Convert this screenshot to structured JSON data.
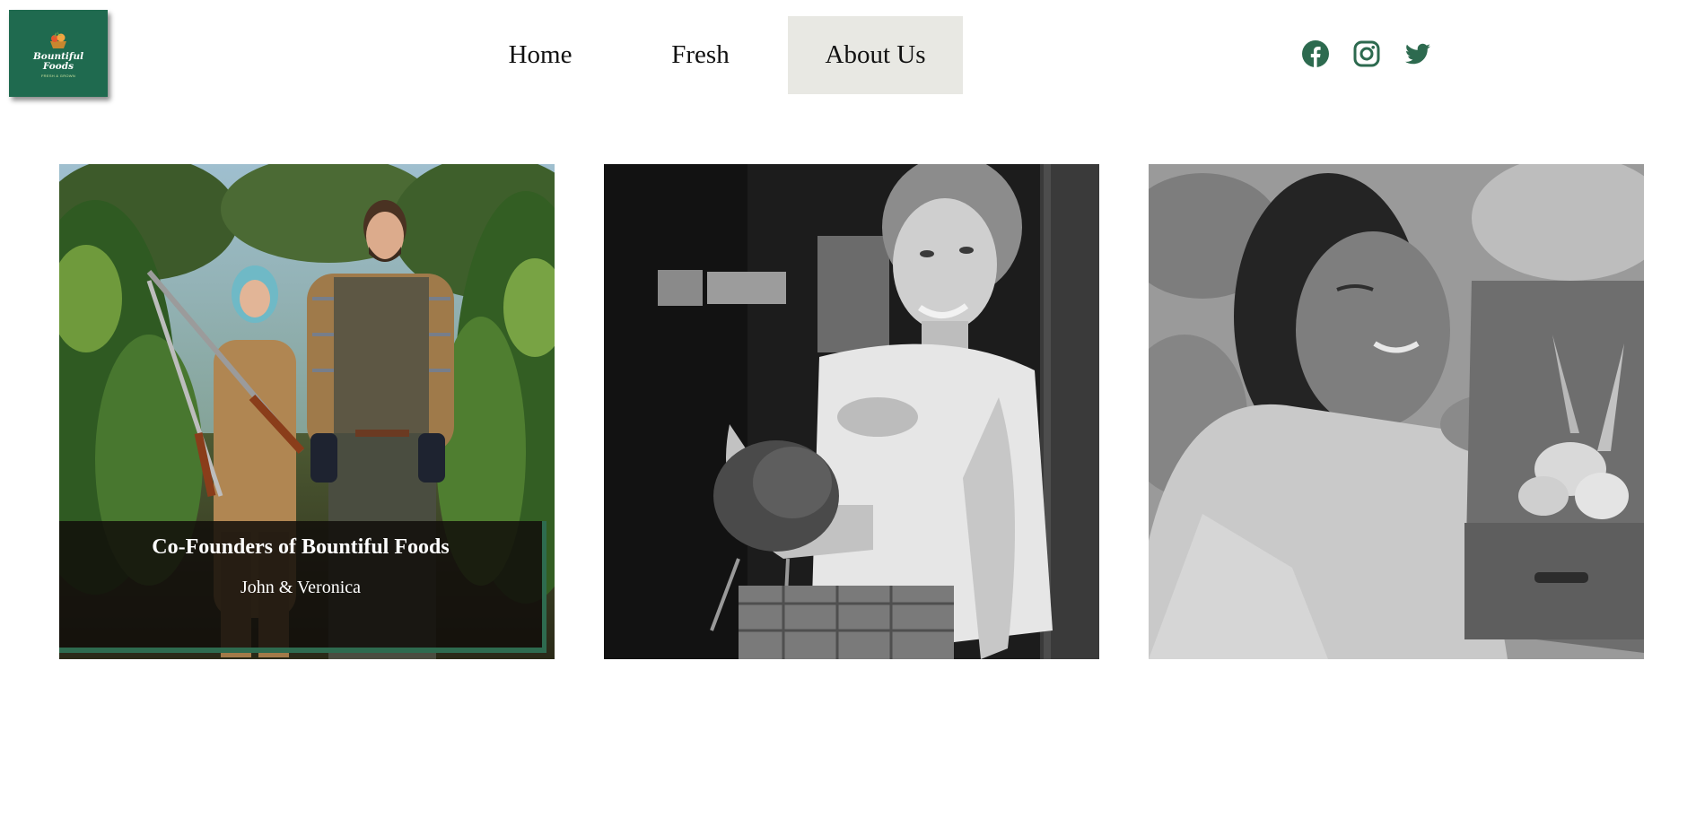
{
  "brand": {
    "name": "Bountiful\nFoods",
    "tagline": "FRESH & GROWN",
    "color": "#1f6a4f"
  },
  "nav": {
    "items": [
      {
        "label": "Home",
        "active": false
      },
      {
        "label": "Fresh",
        "active": false
      },
      {
        "label": "About Us",
        "active": true
      }
    ],
    "active_bg": "#e8e8e3"
  },
  "social": {
    "icons": [
      "facebook-icon",
      "instagram-icon",
      "twitter-icon"
    ],
    "color": "#2d6a4f"
  },
  "gallery": {
    "cards": [
      {
        "image": "co-founders-photo",
        "caption_title": "Co-Founders of Bountiful Foods",
        "caption_subtitle": "John & Veronica"
      },
      {
        "image": "woman-holding-chicken-photo"
      },
      {
        "image": "woman-with-vegetable-crate-photo"
      }
    ],
    "caption_accent": "#2e6b4f"
  }
}
